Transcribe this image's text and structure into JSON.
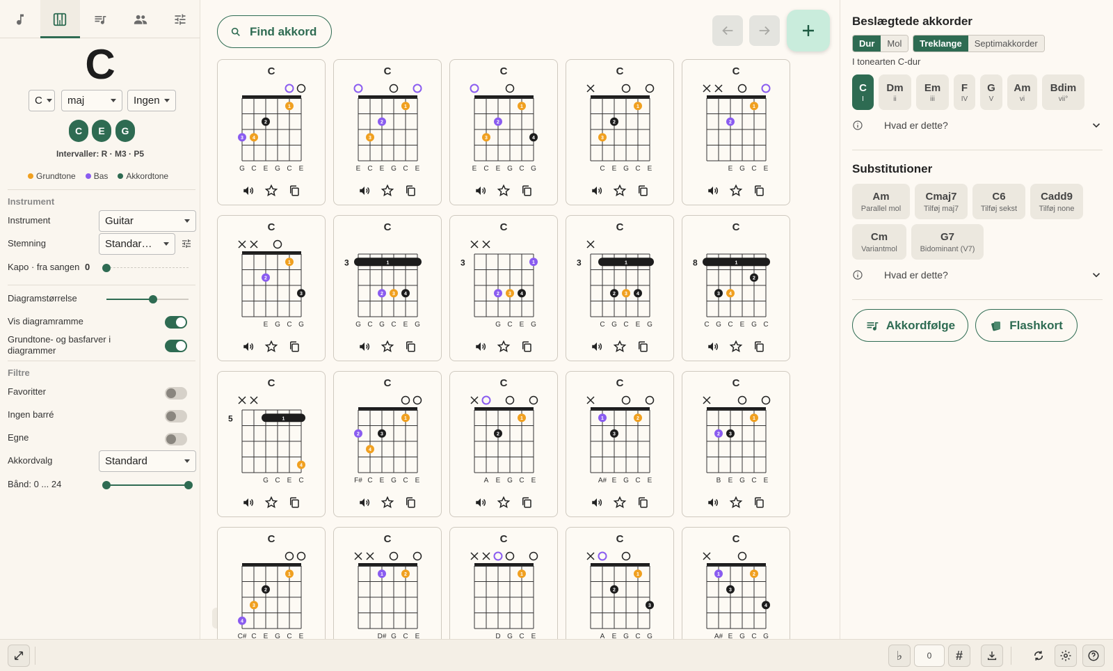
{
  "app": {
    "accent": "#2e6b52",
    "background": "#fdf9f3"
  },
  "tabs": [
    {
      "icon": "music-note-icon"
    },
    {
      "icon": "piano-icon",
      "active": true
    },
    {
      "icon": "playlist-icon"
    },
    {
      "icon": "people-icon"
    },
    {
      "icon": "tune-icon"
    }
  ],
  "chord": {
    "name": "C",
    "root_select": "C",
    "quality_select": "maj",
    "extension_select": "Ingen",
    "notes": [
      "C",
      "E",
      "G"
    ],
    "intervals": "Intervaller: R · M3 · P5",
    "legend": {
      "root": "Grundtone",
      "bass": "Bas",
      "chord_tone": "Akkordtone"
    }
  },
  "settings": {
    "instrument_header": "Instrument",
    "instrument_label": "Instrument",
    "instrument_value": "Guitar",
    "tuning_label": "Stemning",
    "tuning_value": "Standar…",
    "capo_label": "Kapo · fra sangen",
    "capo_value": "0",
    "diagram_size_label": "Diagramstørrelse",
    "diagram_size_level": 0.57,
    "show_frame_label": "Vis diagramramme",
    "show_frame_on": true,
    "colors_label": "Grundtone- og basfarver i diagrammer",
    "colors_on": true,
    "filters_header": "Filtre",
    "favorites_label": "Favoritter",
    "favorites_on": false,
    "no_barre_label": "Ingen barré",
    "no_barre_on": false,
    "own_label": "Egne",
    "own_on": false,
    "chord_choice_label": "Akkordvalg",
    "chord_choice_value": "Standard",
    "frets_label": "Bånd: 0 ... 24"
  },
  "toolbar": {
    "search_label": "Find akkord"
  },
  "chord_cards": [
    {
      "name": "C",
      "notes": [
        "G",
        "C",
        "E",
        "G",
        "C",
        "E"
      ]
    },
    {
      "name": "C",
      "notes": [
        "E",
        "C",
        "E",
        "G",
        "C",
        "E"
      ]
    },
    {
      "name": "C",
      "notes": [
        "E",
        "C",
        "E",
        "G",
        "C",
        "G"
      ]
    },
    {
      "name": "C",
      "notes": [
        "",
        "C",
        "E",
        "G",
        "C",
        "E"
      ]
    },
    {
      "name": "C",
      "notes": [
        "",
        "",
        "E",
        "G",
        "C",
        "E"
      ]
    },
    {
      "name": "C",
      "notes": [
        "",
        "",
        "E",
        "G",
        "C",
        "G"
      ]
    },
    {
      "name": "C",
      "fret_label": "3",
      "notes": [
        "G",
        "C",
        "G",
        "C",
        "E",
        "G"
      ]
    },
    {
      "name": "C",
      "fret_label": "3",
      "notes": [
        "",
        "",
        "G",
        "C",
        "E",
        "G"
      ]
    },
    {
      "name": "C",
      "fret_label": "3",
      "notes": [
        "",
        "C",
        "G",
        "C",
        "E",
        "G"
      ]
    },
    {
      "name": "C",
      "fret_label": "8",
      "notes": [
        "C",
        "G",
        "C",
        "E",
        "G",
        "C"
      ]
    },
    {
      "name": "C",
      "fret_label": "5",
      "notes": [
        "",
        "",
        "G",
        "C",
        "E",
        "C"
      ]
    },
    {
      "name": "C",
      "notes": [
        "F#",
        "C",
        "E",
        "G",
        "C",
        "E"
      ]
    },
    {
      "name": "C",
      "notes": [
        "",
        "A",
        "E",
        "G",
        "C",
        "E"
      ]
    },
    {
      "name": "C",
      "notes": [
        "",
        "A#",
        "E",
        "G",
        "C",
        "E"
      ]
    },
    {
      "name": "C",
      "notes": [
        "",
        "B",
        "E",
        "G",
        "C",
        "E"
      ]
    },
    {
      "name": "C",
      "notes": [
        "C#",
        "C",
        "E",
        "G",
        "C",
        "E"
      ]
    },
    {
      "name": "C",
      "notes": [
        "",
        "",
        "D#",
        "G",
        "C",
        "E"
      ]
    },
    {
      "name": "C",
      "notes": [
        "",
        "",
        "D",
        "G",
        "C",
        "E"
      ]
    },
    {
      "name": "C",
      "notes": [
        "",
        "A",
        "E",
        "G",
        "C",
        "G"
      ]
    },
    {
      "name": "C",
      "notes": [
        "",
        "A#",
        "E",
        "G",
        "C",
        "G"
      ]
    }
  ],
  "related": {
    "title": "Beslægtede akkorder",
    "seg1": [
      "Dur",
      "Mol"
    ],
    "seg2": [
      "Treklange",
      "Septimakkorder"
    ],
    "key_text": "I tonearten C-dur",
    "chords": [
      {
        "name": "C",
        "degree": "I"
      },
      {
        "name": "Dm",
        "degree": "ii"
      },
      {
        "name": "Em",
        "degree": "iii"
      },
      {
        "name": "F",
        "degree": "IV"
      },
      {
        "name": "G",
        "degree": "V"
      },
      {
        "name": "Am",
        "degree": "vi"
      },
      {
        "name": "Bdim",
        "degree": "vii°"
      }
    ],
    "what_is_this": "Hvad er dette?"
  },
  "substitutions": {
    "title": "Substitutioner",
    "items": [
      {
        "name": "Am",
        "desc": "Parallel mol"
      },
      {
        "name": "Cmaj7",
        "desc": "Tilføj maj7"
      },
      {
        "name": "C6",
        "desc": "Tilføj sekst"
      },
      {
        "name": "Cadd9",
        "desc": "Tilføj none"
      },
      {
        "name": "Cm",
        "desc": "Variantmol"
      },
      {
        "name": "G7",
        "desc": "Bidominant (V7)"
      }
    ],
    "what_is_this": "Hvad er dette?"
  },
  "actions": {
    "progression_label": "Akkordfølge",
    "flashcard_label": "Flashkort"
  },
  "bottom_bar": {
    "flat": "♭",
    "transpose": "0",
    "sharp": "#"
  }
}
